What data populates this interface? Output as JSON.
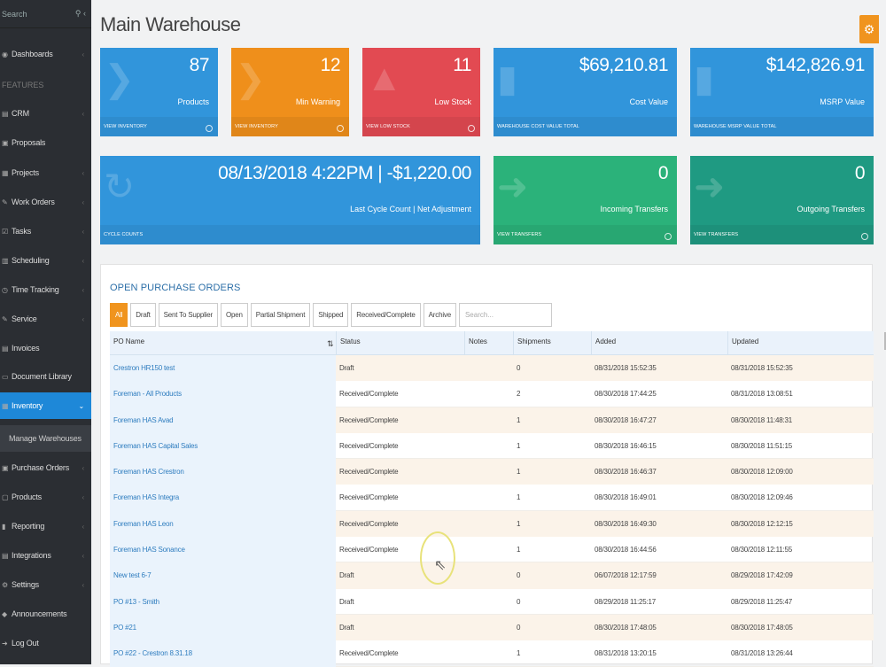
{
  "sidebar": {
    "search_placeholder": "Search",
    "section_features": "FEATURES",
    "items": [
      {
        "label": "Dashboards",
        "icon": "dashboard-icon"
      },
      {
        "label": "CRM",
        "icon": "crm-icon"
      },
      {
        "label": "Proposals",
        "icon": "proposals-icon"
      },
      {
        "label": "Projects",
        "icon": "projects-icon"
      },
      {
        "label": "Work Orders",
        "icon": "work-orders-icon"
      },
      {
        "label": "Tasks",
        "icon": "tasks-icon"
      },
      {
        "label": "Scheduling",
        "icon": "calendar-icon"
      },
      {
        "label": "Time Tracking",
        "icon": "clock-icon"
      },
      {
        "label": "Service",
        "icon": "wrench-icon"
      },
      {
        "label": "Invoices",
        "icon": "invoice-icon"
      },
      {
        "label": "Document Library",
        "icon": "document-icon"
      },
      {
        "label": "Inventory",
        "icon": "inventory-icon"
      },
      {
        "label": "Manage Warehouses",
        "icon": ""
      },
      {
        "label": "Purchase Orders",
        "icon": "cart-icon"
      },
      {
        "label": "Products",
        "icon": "box-icon"
      },
      {
        "label": "Reporting",
        "icon": "chart-icon"
      },
      {
        "label": "Integrations",
        "icon": "plug-icon"
      },
      {
        "label": "Settings",
        "icon": "gear-icon"
      },
      {
        "label": "Announcements",
        "icon": "megaphone-icon"
      },
      {
        "label": "Log Out",
        "icon": "logout-icon"
      }
    ]
  },
  "page": {
    "title": "Main Warehouse"
  },
  "tiles": {
    "products": {
      "value": "87",
      "label": "Products",
      "footer": "VIEW INVENTORY"
    },
    "min_warning": {
      "value": "12",
      "label": "Min Warning",
      "footer": "VIEW INVENTORY"
    },
    "low_stock": {
      "value": "11",
      "label": "Low Stock",
      "footer": "VIEW LOW STOCK"
    },
    "cost_value": {
      "value": "$69,210.81",
      "label": "Cost Value",
      "footer": "WAREHOUSE COST VALUE TOTAL"
    },
    "msrp_value": {
      "value": "$142,826.91",
      "label": "MSRP Value",
      "footer": "WAREHOUSE MSRP VALUE TOTAL"
    },
    "cycle_count": {
      "value": "08/13/2018 4:22PM | -$1,220.00",
      "label": "Last Cycle Count | Net Adjustment",
      "footer": "CYCLE COUNTS"
    },
    "incoming": {
      "value": "0",
      "label": "Incoming Transfers",
      "footer": "VIEW TRANSFERS"
    },
    "outgoing": {
      "value": "0",
      "label": "Outgoing Transfers",
      "footer": "VIEW TRANSFERS"
    }
  },
  "purchase_orders": {
    "title": "OPEN PURCHASE ORDERS",
    "filters": [
      "All",
      "Draft",
      "Sent To Supplier",
      "Open",
      "Partial Shipment",
      "Shipped",
      "Received/Complete",
      "Archive"
    ],
    "search_placeholder": "Search...",
    "columns": [
      "PO Name",
      "Status",
      "Notes",
      "Shipments",
      "Added",
      "Updated"
    ],
    "rows": [
      [
        "Crestron HR150 test",
        "Draft",
        "",
        "0",
        "08/31/2018 15:52:35",
        "08/31/2018 15:52:35"
      ],
      [
        "Foreman - All Products",
        "Received/Complete",
        "",
        "2",
        "08/30/2018 17:44:25",
        "08/31/2018 13:08:51"
      ],
      [
        "Foreman HAS Avad",
        "Received/Complete",
        "",
        "1",
        "08/30/2018 16:47:27",
        "08/30/2018 11:48:31"
      ],
      [
        "Foreman HAS Capital Sales",
        "Received/Complete",
        "",
        "1",
        "08/30/2018 16:46:15",
        "08/30/2018 11:51:15"
      ],
      [
        "Foreman HAS Crestron",
        "Received/Complete",
        "",
        "1",
        "08/30/2018 16:46:37",
        "08/30/2018 12:09:00"
      ],
      [
        "Foreman HAS Integra",
        "Received/Complete",
        "",
        "1",
        "08/30/2018 16:49:01",
        "08/30/2018 12:09:46"
      ],
      [
        "Foreman HAS Leon",
        "Received/Complete",
        "",
        "1",
        "08/30/2018 16:49:30",
        "08/30/2018 12:12:15"
      ],
      [
        "Foreman HAS Sonance",
        "Received/Complete",
        "",
        "1",
        "08/30/2018 16:44:56",
        "08/30/2018 12:11:55"
      ],
      [
        "New test 6-7",
        "Draft",
        "",
        "0",
        "06/07/2018 12:17:59",
        "08/29/2018 17:42:09"
      ],
      [
        "PO #13 - Smith",
        "Draft",
        "",
        "0",
        "08/29/2018 11:25:17",
        "08/29/2018 11:25:47"
      ],
      [
        "PO #21",
        "Draft",
        "",
        "0",
        "08/30/2018 17:48:05",
        "08/30/2018 17:48:05"
      ],
      [
        "PO #22 - Crestron 8.31.18",
        "Received/Complete",
        "",
        "1",
        "08/31/2018 13:20:15",
        "08/31/2018 13:26:44"
      ]
    ]
  },
  "colors": {
    "accent": "#f0941e",
    "primary": "#3195db",
    "danger": "#e24a52",
    "success": "#2bb27a",
    "teal": "#1f9a82",
    "sidebar": "#2b2e33"
  }
}
